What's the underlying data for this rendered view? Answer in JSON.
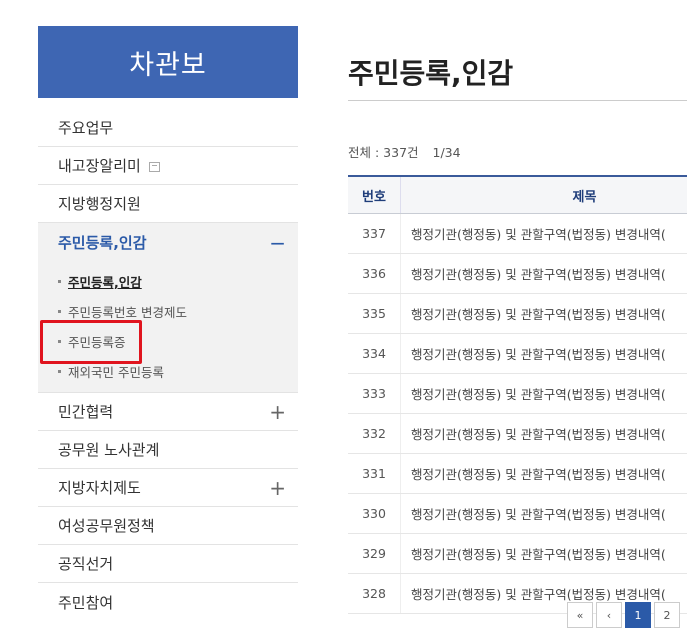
{
  "sidebar": {
    "title": "차관보",
    "items": [
      {
        "label": "주요업무",
        "toggle": ""
      },
      {
        "label": "내고장알리미",
        "toggle": ""
      },
      {
        "label": "지방행정지원",
        "toggle": ""
      },
      {
        "label": "주민등록,인감",
        "toggle": "−"
      },
      {
        "label": "민간협력",
        "toggle": "+"
      },
      {
        "label": "공무원 노사관계",
        "toggle": ""
      },
      {
        "label": "지방자치제도",
        "toggle": "+"
      },
      {
        "label": "여성공무원정책",
        "toggle": ""
      },
      {
        "label": "공직선거",
        "toggle": ""
      },
      {
        "label": "주민참여",
        "toggle": ""
      }
    ],
    "submenu": [
      {
        "label": "주민등록,인감"
      },
      {
        "label": "주민등록번호 변경제도"
      },
      {
        "label": "주민등록증"
      },
      {
        "label": "재외국민 주민등록"
      }
    ]
  },
  "main": {
    "title": "주민등록,인감",
    "summary_total": "전체 : 337건",
    "summary_page": "1/34",
    "table": {
      "headers": [
        "번호",
        "제목"
      ],
      "rows": [
        {
          "num": "337",
          "title": "행정기관(행정동) 및 관할구역(법정동) 변경내역("
        },
        {
          "num": "336",
          "title": "행정기관(행정동) 및 관할구역(법정동) 변경내역("
        },
        {
          "num": "335",
          "title": "행정기관(행정동) 및 관할구역(법정동) 변경내역("
        },
        {
          "num": "334",
          "title": "행정기관(행정동) 및 관할구역(법정동) 변경내역("
        },
        {
          "num": "333",
          "title": "행정기관(행정동) 및 관할구역(법정동) 변경내역("
        },
        {
          "num": "332",
          "title": "행정기관(행정동) 및 관할구역(법정동) 변경내역("
        },
        {
          "num": "331",
          "title": "행정기관(행정동) 및 관할구역(법정동) 변경내역("
        },
        {
          "num": "330",
          "title": "행정기관(행정동) 및 관할구역(법정동) 변경내역("
        },
        {
          "num": "329",
          "title": "행정기관(행정동) 및 관할구역(법정동) 변경내역("
        },
        {
          "num": "328",
          "title": "행정기관(행정동) 및 관할구역(법정동) 변경내역("
        }
      ]
    },
    "pager": {
      "first": "«",
      "prev": "‹",
      "pages": [
        "1",
        "2"
      ]
    }
  },
  "colors": {
    "sidebar_header": "#3e66b3",
    "accent": "#2b5aa8",
    "highlight": "#e0141e"
  }
}
